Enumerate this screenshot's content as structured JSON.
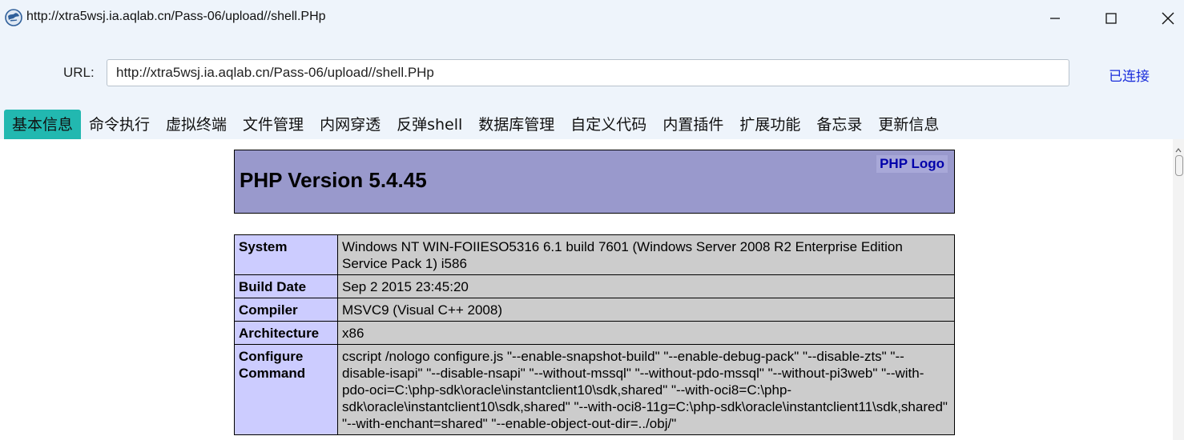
{
  "window": {
    "title": "http://xtra5wsj.ia.aqlab.cn/Pass-06/upload//shell.PHp",
    "app_icon": "globe-icon",
    "controls": [
      "minimize-icon",
      "maximize-icon",
      "close-icon"
    ]
  },
  "url_bar": {
    "label": "URL:",
    "value": "http://xtra5wsj.ia.aqlab.cn/Pass-06/upload//shell.PHp",
    "status": "已连接"
  },
  "tabs": [
    {
      "label": "基本信息",
      "active": true
    },
    {
      "label": "命令执行"
    },
    {
      "label": "虚拟终端"
    },
    {
      "label": "文件管理"
    },
    {
      "label": "内网穿透"
    },
    {
      "label": "反弹shell"
    },
    {
      "label": "数据库管理"
    },
    {
      "label": "自定义代码"
    },
    {
      "label": "内置插件"
    },
    {
      "label": "扩展功能"
    },
    {
      "label": "备忘录"
    },
    {
      "label": "更新信息"
    }
  ],
  "phpinfo": {
    "version": "PHP Version 5.4.45",
    "logo": "PHP Logo",
    "rows": [
      {
        "key": "System",
        "value": "Windows NT WIN-FOIIESO5316 6.1 build 7601 (Windows Server 2008 R2 Enterprise Edition Service Pack 1) i586"
      },
      {
        "key": "Build Date",
        "value": "Sep 2 2015 23:45:20"
      },
      {
        "key": "Compiler",
        "value": "MSVC9 (Visual C++ 2008)"
      },
      {
        "key": "Architecture",
        "value": "x86"
      },
      {
        "key": "Configure Command",
        "value": "cscript /nologo configure.js \"--enable-snapshot-build\" \"--enable-debug-pack\" \"--disable-zts\" \"--disable-isapi\" \"--disable-nsapi\" \"--without-mssql\" \"--without-pdo-mssql\" \"--without-pi3web\" \"--with-pdo-oci=C:\\php-sdk\\oracle\\instantclient10\\sdk,shared\" \"--with-oci8=C:\\php-sdk\\oracle\\instantclient10\\sdk,shared\" \"--with-oci8-11g=C:\\php-sdk\\oracle\\instantclient11\\sdk,shared\" \"--with-enchant=shared\" \"--enable-object-out-dir=../obj/\""
      }
    ]
  },
  "colors": {
    "titlebar_bg": "#eef4fb",
    "active_tab": "#22b8b0",
    "status_link": "#1a2ddb",
    "php_header": "#9999cc",
    "key_cell": "#ccccff",
    "value_cell": "#cccccc"
  }
}
